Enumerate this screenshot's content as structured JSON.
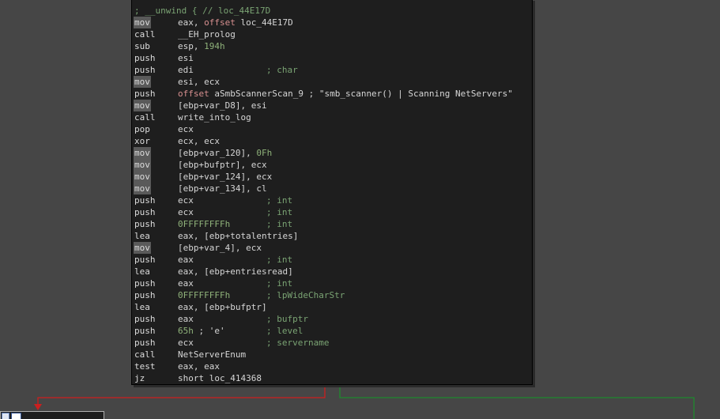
{
  "colors": {
    "canvas_bg": "#464646",
    "block_bg": "#1e1e1e",
    "instruction_text": "#d6d6d6",
    "comment_text": "#7aa373",
    "number_text": "#8fb27a",
    "keyword_text": "#d68f8f",
    "false_edge": "#cc1f1f",
    "true_edge": "#1e8a2e"
  },
  "block": {
    "header_comment": "; __unwind { // loc_44E17D",
    "lines": [
      {
        "mnemonic": "mov",
        "highlight": true,
        "tokens": [
          {
            "t": "eax, ",
            "k": "plain"
          },
          {
            "t": "offset",
            "k": "kw"
          },
          {
            "t": " loc_44E17D",
            "k": "plain"
          }
        ],
        "comment": ""
      },
      {
        "mnemonic": "call",
        "highlight": false,
        "tokens": [
          {
            "t": "__EH_prolog",
            "k": "plain"
          }
        ],
        "comment": ""
      },
      {
        "mnemonic": "sub",
        "highlight": false,
        "tokens": [
          {
            "t": "esp, ",
            "k": "plain"
          },
          {
            "t": "194h",
            "k": "num"
          }
        ],
        "comment": ""
      },
      {
        "mnemonic": "push",
        "highlight": false,
        "tokens": [
          {
            "t": "esi",
            "k": "plain"
          }
        ],
        "comment": ""
      },
      {
        "mnemonic": "push",
        "highlight": false,
        "tokens": [
          {
            "t": "edi",
            "k": "plain"
          }
        ],
        "comment": "; char"
      },
      {
        "mnemonic": "mov",
        "highlight": true,
        "tokens": [
          {
            "t": "esi, ecx",
            "k": "plain"
          }
        ],
        "comment": ""
      },
      {
        "mnemonic": "push",
        "highlight": false,
        "tokens": [
          {
            "t": "offset",
            "k": "kw"
          },
          {
            "t": " aSmbScannerScan_9",
            "k": "plain"
          },
          {
            "t": " ; \"smb_scanner() | Scanning NetServers\"",
            "k": "str"
          }
        ],
        "comment": ""
      },
      {
        "mnemonic": "mov",
        "highlight": true,
        "tokens": [
          {
            "t": "[ebp+var_D8], esi",
            "k": "plain"
          }
        ],
        "comment": ""
      },
      {
        "mnemonic": "call",
        "highlight": false,
        "tokens": [
          {
            "t": "write_into_log",
            "k": "plain"
          }
        ],
        "comment": ""
      },
      {
        "mnemonic": "pop",
        "highlight": false,
        "tokens": [
          {
            "t": "ecx",
            "k": "plain"
          }
        ],
        "comment": ""
      },
      {
        "mnemonic": "xor",
        "highlight": false,
        "tokens": [
          {
            "t": "ecx, ecx",
            "k": "plain"
          }
        ],
        "comment": ""
      },
      {
        "mnemonic": "mov",
        "highlight": true,
        "tokens": [
          {
            "t": "[ebp+var_120], ",
            "k": "plain"
          },
          {
            "t": "0Fh",
            "k": "num"
          }
        ],
        "comment": ""
      },
      {
        "mnemonic": "mov",
        "highlight": true,
        "tokens": [
          {
            "t": "[ebp+bufptr], ecx",
            "k": "plain"
          }
        ],
        "comment": ""
      },
      {
        "mnemonic": "mov",
        "highlight": true,
        "tokens": [
          {
            "t": "[ebp+var_124], ecx",
            "k": "plain"
          }
        ],
        "comment": ""
      },
      {
        "mnemonic": "mov",
        "highlight": true,
        "tokens": [
          {
            "t": "[ebp+var_134], cl",
            "k": "plain"
          }
        ],
        "comment": ""
      },
      {
        "mnemonic": "push",
        "highlight": false,
        "tokens": [
          {
            "t": "ecx",
            "k": "plain"
          }
        ],
        "comment": "; int"
      },
      {
        "mnemonic": "push",
        "highlight": false,
        "tokens": [
          {
            "t": "ecx",
            "k": "plain"
          }
        ],
        "comment": "; int"
      },
      {
        "mnemonic": "push",
        "highlight": false,
        "tokens": [
          {
            "t": "0FFFFFFFFh",
            "k": "num"
          }
        ],
        "comment": "; int"
      },
      {
        "mnemonic": "lea",
        "highlight": false,
        "tokens": [
          {
            "t": "eax, [ebp+totalentries]",
            "k": "plain"
          }
        ],
        "comment": ""
      },
      {
        "mnemonic": "mov",
        "highlight": true,
        "tokens": [
          {
            "t": "[ebp+var_4], ecx",
            "k": "plain"
          }
        ],
        "comment": ""
      },
      {
        "mnemonic": "push",
        "highlight": false,
        "tokens": [
          {
            "t": "eax",
            "k": "plain"
          }
        ],
        "comment": "; int"
      },
      {
        "mnemonic": "lea",
        "highlight": false,
        "tokens": [
          {
            "t": "eax, [ebp+entriesread]",
            "k": "plain"
          }
        ],
        "comment": ""
      },
      {
        "mnemonic": "push",
        "highlight": false,
        "tokens": [
          {
            "t": "eax",
            "k": "plain"
          }
        ],
        "comment": "; int"
      },
      {
        "mnemonic": "push",
        "highlight": false,
        "tokens": [
          {
            "t": "0FFFFFFFFh",
            "k": "num"
          }
        ],
        "comment": "; lpWideCharStr"
      },
      {
        "mnemonic": "lea",
        "highlight": false,
        "tokens": [
          {
            "t": "eax, [ebp+bufptr]",
            "k": "plain"
          }
        ],
        "comment": ""
      },
      {
        "mnemonic": "push",
        "highlight": false,
        "tokens": [
          {
            "t": "eax",
            "k": "plain"
          }
        ],
        "comment": "; bufptr"
      },
      {
        "mnemonic": "push",
        "highlight": false,
        "tokens": [
          {
            "t": "65h",
            "k": "num"
          },
          {
            "t": " ; 'e'",
            "k": "cm"
          }
        ],
        "comment": "; level"
      },
      {
        "mnemonic": "push",
        "highlight": false,
        "tokens": [
          {
            "t": "ecx",
            "k": "plain"
          }
        ],
        "comment": "; servername"
      },
      {
        "mnemonic": "call",
        "highlight": false,
        "tokens": [
          {
            "t": "NetServerEnum",
            "k": "plain"
          }
        ],
        "comment": ""
      },
      {
        "mnemonic": "test",
        "highlight": false,
        "tokens": [
          {
            "t": "eax, eax",
            "k": "plain"
          }
        ],
        "comment": ""
      },
      {
        "mnemonic": "jz",
        "highlight": false,
        "tokens": [
          {
            "t": "short loc_414368",
            "k": "plain"
          }
        ],
        "comment": ""
      }
    ]
  },
  "next_node": {
    "icons": [
      "node-icon",
      "graph-overview-icon"
    ]
  }
}
